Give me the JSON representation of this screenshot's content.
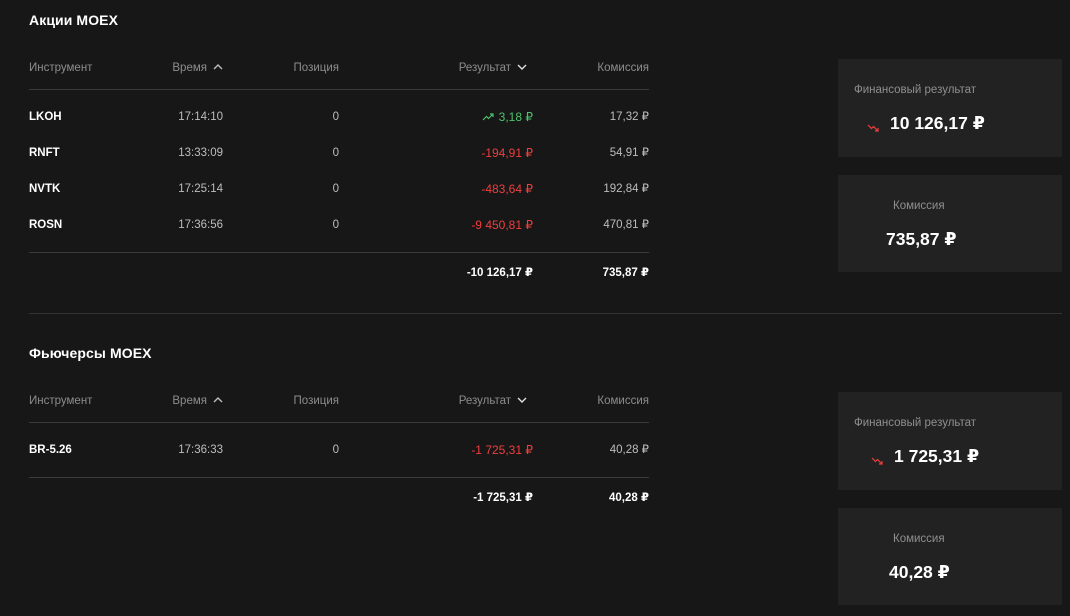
{
  "headers": {
    "instrument": "Инструмент",
    "time": "Время",
    "position": "Позиция",
    "result": "Результат",
    "commission": "Комиссия"
  },
  "stocks": {
    "title": "Акции MOEX",
    "rows": [
      {
        "instrument": "LKOH",
        "time": "17:14:10",
        "position": "0",
        "result": "3,18 ₽",
        "commission": "17,32 ₽",
        "direction": "up"
      },
      {
        "instrument": "RNFT",
        "time": "13:33:09",
        "position": "0",
        "result": "-194,91 ₽",
        "commission": "54,91 ₽",
        "direction": "down"
      },
      {
        "instrument": "NVTK",
        "time": "17:25:14",
        "position": "0",
        "result": "-483,64 ₽",
        "commission": "192,84 ₽",
        "direction": "down"
      },
      {
        "instrument": "ROSN",
        "time": "17:36:56",
        "position": "0",
        "result": "-9 450,81 ₽",
        "commission": "470,81 ₽",
        "direction": "down"
      }
    ],
    "total_result": "-10 126,17 ₽",
    "total_commission": "735,87 ₽",
    "summary": {
      "fin_label": "Финансовый результат",
      "fin_value": "10 126,17 ₽",
      "comm_label": "Комиссия",
      "comm_value": "735,87 ₽"
    }
  },
  "futures": {
    "title": "Фьючерсы MOEX",
    "rows": [
      {
        "instrument": "BR-5.26",
        "time": "17:36:33",
        "position": "0",
        "result": "-1 725,31 ₽",
        "commission": "40,28 ₽",
        "direction": "down"
      }
    ],
    "total_result": "-1 725,31 ₽",
    "total_commission": "40,28 ₽",
    "summary": {
      "fin_label": "Финансовый результат",
      "fin_value": "1 725,31 ₽",
      "comm_label": "Комиссия",
      "comm_value": "40,28 ₽"
    }
  },
  "colors": {
    "background": "#171717",
    "card": "#222222",
    "positive": "#4ec16a",
    "negative": "#ef3e3e"
  }
}
